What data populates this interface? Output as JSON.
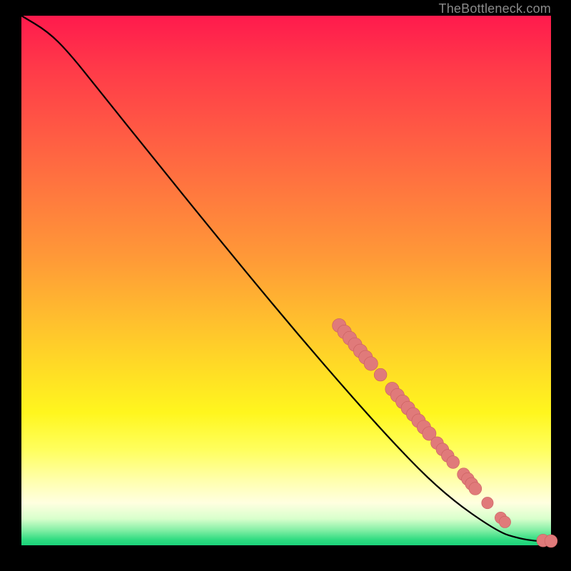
{
  "watermark": "TheBottleneck.com",
  "colors": {
    "gradient_top": "#ff1a4d",
    "gradient_mid1": "#ff9a37",
    "gradient_mid2": "#fff61e",
    "gradient_bottom": "#1bd37a",
    "curve": "#000000",
    "points_fill": "#e07a7a",
    "points_stroke": "#c95f5f"
  },
  "chart_data": {
    "type": "line",
    "title": "",
    "xlabel": "",
    "ylabel": "",
    "xlim": [
      0,
      100
    ],
    "ylim": [
      0,
      100
    ],
    "curve": [
      {
        "x": 0,
        "y": 100
      },
      {
        "x": 5,
        "y": 97
      },
      {
        "x": 9,
        "y": 93
      },
      {
        "x": 15,
        "y": 85.5
      },
      {
        "x": 25,
        "y": 73
      },
      {
        "x": 40,
        "y": 54.5
      },
      {
        "x": 55,
        "y": 36.5
      },
      {
        "x": 70,
        "y": 19.5
      },
      {
        "x": 80,
        "y": 9.5
      },
      {
        "x": 90,
        "y": 2.5
      },
      {
        "x": 94,
        "y": 1.3
      },
      {
        "x": 97,
        "y": 0.8
      },
      {
        "x": 100,
        "y": 0.7
      }
    ],
    "points": [
      {
        "x": 60.0,
        "y": 41.5,
        "r": 1.3
      },
      {
        "x": 61.0,
        "y": 40.3,
        "r": 1.3
      },
      {
        "x": 62.0,
        "y": 39.1,
        "r": 1.3
      },
      {
        "x": 63.0,
        "y": 37.9,
        "r": 1.3
      },
      {
        "x": 64.0,
        "y": 36.7,
        "r": 1.3
      },
      {
        "x": 65.0,
        "y": 35.5,
        "r": 1.3
      },
      {
        "x": 66.0,
        "y": 34.3,
        "r": 1.3
      },
      {
        "x": 67.8,
        "y": 32.2,
        "r": 1.2
      },
      {
        "x": 70.0,
        "y": 29.5,
        "r": 1.3
      },
      {
        "x": 71.0,
        "y": 28.3,
        "r": 1.3
      },
      {
        "x": 72.0,
        "y": 27.1,
        "r": 1.3
      },
      {
        "x": 73.0,
        "y": 25.9,
        "r": 1.3
      },
      {
        "x": 74.0,
        "y": 24.7,
        "r": 1.3
      },
      {
        "x": 75.0,
        "y": 23.5,
        "r": 1.3
      },
      {
        "x": 76.0,
        "y": 22.3,
        "r": 1.3
      },
      {
        "x": 77.0,
        "y": 21.1,
        "r": 1.3
      },
      {
        "x": 78.5,
        "y": 19.3,
        "r": 1.2
      },
      {
        "x": 79.5,
        "y": 18.1,
        "r": 1.2
      },
      {
        "x": 80.5,
        "y": 16.9,
        "r": 1.2
      },
      {
        "x": 81.5,
        "y": 15.7,
        "r": 1.2
      },
      {
        "x": 83.5,
        "y": 13.4,
        "r": 1.2
      },
      {
        "x": 84.3,
        "y": 12.5,
        "r": 1.2
      },
      {
        "x": 85.0,
        "y": 11.6,
        "r": 1.2
      },
      {
        "x": 85.7,
        "y": 10.7,
        "r": 1.2
      },
      {
        "x": 88.0,
        "y": 8.0,
        "r": 1.1
      },
      {
        "x": 90.5,
        "y": 5.2,
        "r": 1.1
      },
      {
        "x": 91.3,
        "y": 4.4,
        "r": 1.1
      },
      {
        "x": 98.5,
        "y": 0.9,
        "r": 1.2
      },
      {
        "x": 100.0,
        "y": 0.8,
        "r": 1.2
      }
    ]
  }
}
